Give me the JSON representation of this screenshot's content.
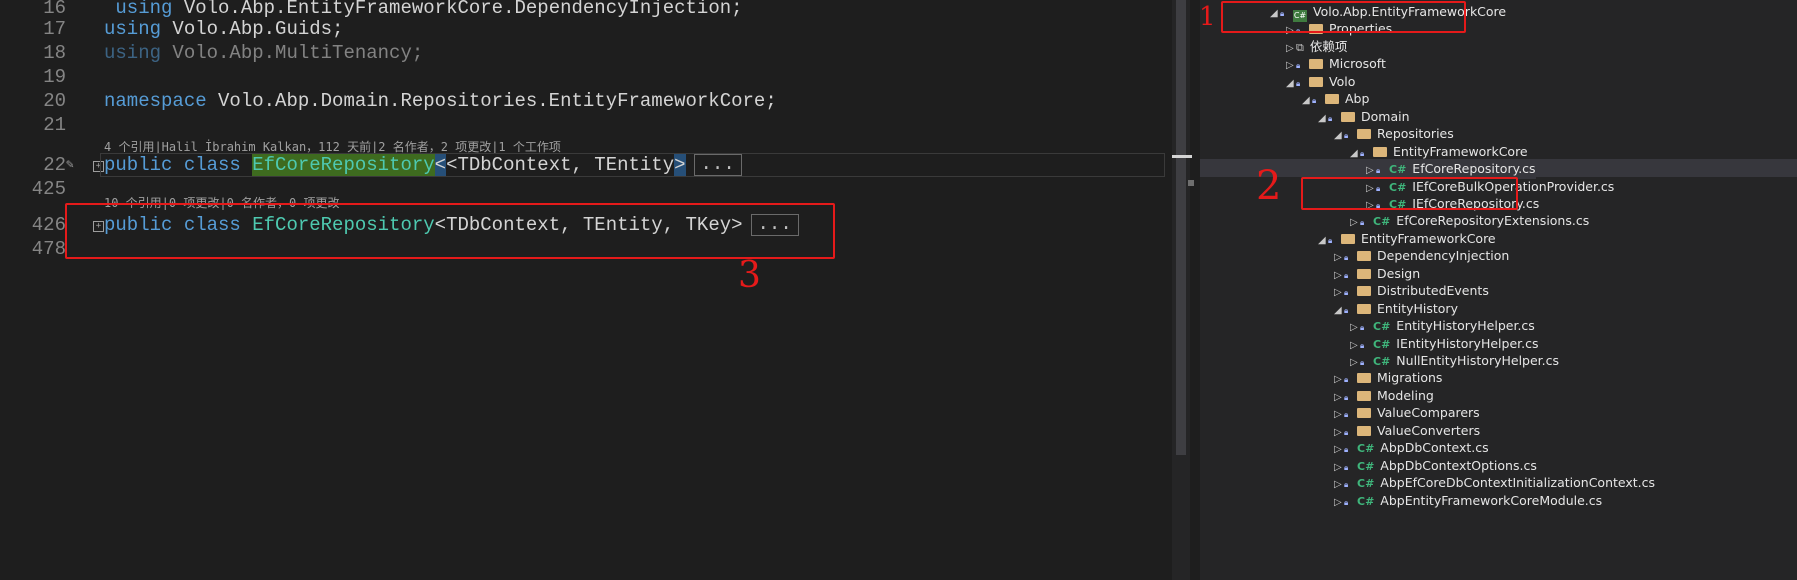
{
  "editor": {
    "lines": [
      {
        "num": "16",
        "text": "using Volo.Abp.EntityFrameworkCore.DependencyInjection;",
        "dim": false
      },
      {
        "num": "17",
        "text": "using Volo.Abp.Guids;",
        "dim": false
      },
      {
        "num": "18",
        "text": "using Volo.Abp.MultiTenancy;",
        "dim": true
      },
      {
        "num": "19",
        "text": "",
        "dim": false
      },
      {
        "num": "20",
        "text": "namespace Volo.Abp.Domain.Repositories.EntityFrameworkCore;",
        "dim": false
      },
      {
        "num": "21",
        "text": "",
        "dim": false
      }
    ],
    "lens1": "4 个引用|Halil İbrahim Kalkan，112 天前|2 名作者，2 项更改|1 个工作项",
    "class1": {
      "num": "22",
      "kw": "public class ",
      "name": "EfCoreRepository",
      "generics": "<TDbContext, TEntity",
      "close": ">",
      "collapsed": "..."
    },
    "num_425": "425",
    "lens2": "10 个引用|0 项更改|0 名作者，0 项更改",
    "class2": {
      "num": "426",
      "kw": "public class ",
      "name": "EfCoreRepository",
      "generics": "<TDbContext, TEntity, TKey>",
      "collapsed": "..."
    },
    "num_478": "478"
  },
  "explorer": {
    "rows": [
      {
        "level": 0,
        "arrow": "◢",
        "icon": "project",
        "label": "Volo.Abp.EntityFrameworkCore"
      },
      {
        "level": 1,
        "arrow": "▷",
        "icon": "folder",
        "label": "Properties"
      },
      {
        "level": 1,
        "arrow": "▷",
        "icon": "dep",
        "label": "依赖项"
      },
      {
        "level": 1,
        "arrow": "▷",
        "icon": "folder",
        "label": "Microsoft"
      },
      {
        "level": 1,
        "arrow": "◢",
        "icon": "folder",
        "label": "Volo"
      },
      {
        "level": 2,
        "arrow": "◢",
        "icon": "folder",
        "label": "Abp"
      },
      {
        "level": 3,
        "arrow": "◢",
        "icon": "folder",
        "label": "Domain"
      },
      {
        "level": 4,
        "arrow": "◢",
        "icon": "folder",
        "label": "Repositories"
      },
      {
        "level": 5,
        "arrow": "◢",
        "icon": "folder",
        "label": "EntityFrameworkCore"
      },
      {
        "level": 6,
        "arrow": "▷",
        "icon": "cs",
        "label": "EfCoreRepository.cs"
      },
      {
        "level": 6,
        "arrow": "▷",
        "icon": "cs",
        "label": "IEfCoreBulkOperationProvider.cs"
      },
      {
        "level": 6,
        "arrow": "▷",
        "icon": "cs",
        "label": "IEfCoreRepository.cs"
      },
      {
        "level": 5,
        "arrow": "▷",
        "icon": "cs",
        "label": "EfCoreRepositoryExtensions.cs"
      },
      {
        "level": 3,
        "arrow": "◢",
        "icon": "folder",
        "label": "EntityFrameworkCore"
      },
      {
        "level": 4,
        "arrow": "▷",
        "icon": "folder",
        "label": "DependencyInjection"
      },
      {
        "level": 4,
        "arrow": "▷",
        "icon": "folder",
        "label": "Design"
      },
      {
        "level": 4,
        "arrow": "▷",
        "icon": "folder",
        "label": "DistributedEvents"
      },
      {
        "level": 4,
        "arrow": "◢",
        "icon": "folder",
        "label": "EntityHistory"
      },
      {
        "level": 5,
        "arrow": "▷",
        "icon": "cs",
        "label": "EntityHistoryHelper.cs"
      },
      {
        "level": 5,
        "arrow": "▷",
        "icon": "cs",
        "label": "IEntityHistoryHelper.cs"
      },
      {
        "level": 5,
        "arrow": "▷",
        "icon": "cs",
        "label": "NullEntityHistoryHelper.cs"
      },
      {
        "level": 4,
        "arrow": "▷",
        "icon": "folder",
        "label": "Migrations"
      },
      {
        "level": 4,
        "arrow": "▷",
        "icon": "folder",
        "label": "Modeling"
      },
      {
        "level": 4,
        "arrow": "▷",
        "icon": "folder",
        "label": "ValueComparers"
      },
      {
        "level": 4,
        "arrow": "▷",
        "icon": "folder",
        "label": "ValueConverters"
      },
      {
        "level": 4,
        "arrow": "▷",
        "icon": "cs",
        "label": "AbpDbContext.cs"
      },
      {
        "level": 4,
        "arrow": "▷",
        "icon": "cs",
        "label": "AbpDbContextOptions.cs"
      },
      {
        "level": 4,
        "arrow": "▷",
        "icon": "cs",
        "label": "AbpEfCoreDbContextInitializationContext.cs"
      },
      {
        "level": 4,
        "arrow": "▷",
        "icon": "cs",
        "label": "AbpEntityFrameworkCoreModule.cs"
      }
    ]
  },
  "annotations": {
    "mark1": "1",
    "mark2": "2",
    "mark3": "3"
  }
}
